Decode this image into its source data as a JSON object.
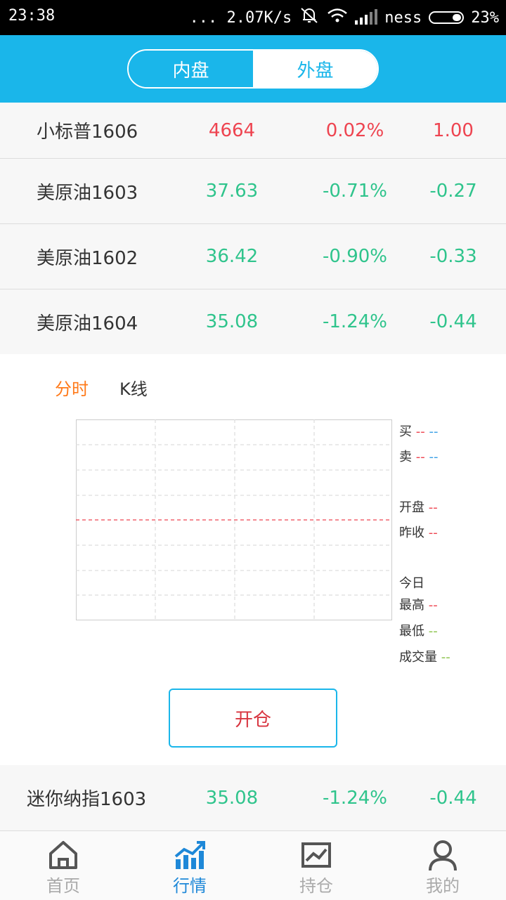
{
  "status_bar": {
    "time": "23:38",
    "network_speed": "... 2.07K/s",
    "carrier": "ness",
    "battery": "23%"
  },
  "header": {
    "tabs": [
      {
        "label": "内盘",
        "active": false
      },
      {
        "label": "外盘",
        "active": true
      }
    ]
  },
  "quotes": [
    {
      "name": "小标普1606",
      "price": "4664",
      "pct": "0.02%",
      "change": "1.00",
      "direction": "up"
    },
    {
      "name": "美原油1603",
      "price": "37.63",
      "pct": "-0.71%",
      "change": "-0.27",
      "direction": "down"
    },
    {
      "name": "美原油1602",
      "price": "36.42",
      "pct": "-0.90%",
      "change": "-0.33",
      "direction": "down"
    },
    {
      "name": "美原油1604",
      "price": "35.08",
      "pct": "-1.24%",
      "change": "-0.44",
      "direction": "down"
    }
  ],
  "detail": {
    "tabs": [
      {
        "label": "分时",
        "active": true
      },
      {
        "label": "K线",
        "active": false
      }
    ],
    "legend": {
      "buy": "买",
      "sell": "卖",
      "open": "开盘",
      "prev_close": "昨收",
      "today": "今日",
      "high": "最高",
      "low": "最低",
      "volume": "成交量",
      "dash": "--"
    },
    "open_button": "开仓"
  },
  "bottom_quote": {
    "name": "迷你纳指1603",
    "price": "35.08",
    "pct": "-1.24%",
    "change": "-0.44",
    "direction": "down"
  },
  "nav": [
    {
      "label": "首页",
      "icon": "home-icon",
      "active": false
    },
    {
      "label": "行情",
      "icon": "chart-icon",
      "active": true
    },
    {
      "label": "持仓",
      "icon": "holdings-icon",
      "active": false
    },
    {
      "label": "我的",
      "icon": "profile-icon",
      "active": false
    }
  ],
  "colors": {
    "accent": "#1ab6ea",
    "up": "#ee4450",
    "down": "#2fc48c",
    "tab_active": "#ff7a1a"
  }
}
